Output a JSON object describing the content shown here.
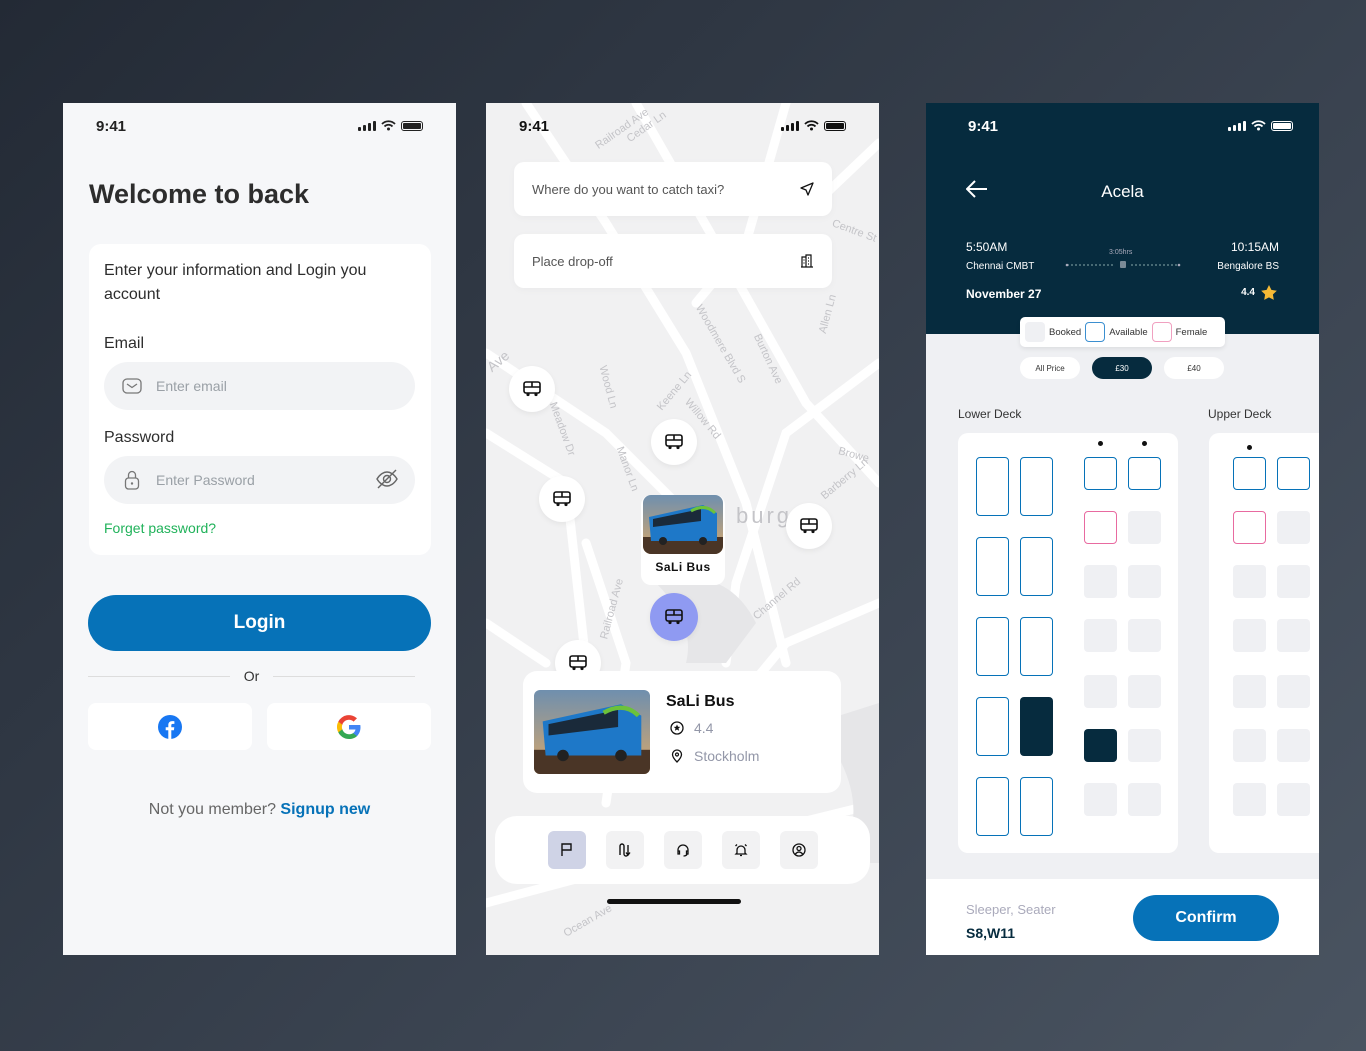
{
  "login_screen": {
    "time": "9:41",
    "title": "Welcome to back",
    "intro": "Enter your information and Login you account",
    "email_label": "Email",
    "email_placeholder": "Enter email",
    "password_label": "Password",
    "password_placeholder": "Enter Password",
    "forgot": "Forget password?",
    "login": "Login",
    "or": "Or",
    "signup_prompt": "Not you member?",
    "signup_link": "Signup new",
    "colors": {
      "primary": "#0672b8",
      "link_green": "#20b25a"
    }
  },
  "map_screen": {
    "time": "9:41",
    "search_placeholder": "Where do you want to catch taxi?",
    "dropoff_placeholder": "Place drop-off",
    "map_labels": [
      "Railroad Ave",
      "Cedar Ln",
      "Woodmere Blvd S",
      "Burton Ave",
      "Keene Ln",
      "Willow Rd",
      "Wood Ln",
      "Meadow Dr",
      "Manor Ln",
      "Railroad Ave",
      "Channel Rd",
      "Barberry Ln",
      "Browe",
      "Allen Ln",
      "Centre St",
      "Ocean Ave",
      "burg",
      "Ave"
    ],
    "bubble_name": "SaLi Bus",
    "card": {
      "name": "SaLi Bus",
      "rating": "4.4",
      "location": "Stockholm"
    },
    "tabs": [
      "flag-icon",
      "route-icon",
      "headset-icon",
      "alarm-icon",
      "profile-icon"
    ],
    "active_tab": 0,
    "colors": {
      "active_pin": "#8f9af2",
      "active_tab": "#cfd3e6"
    }
  },
  "seat_screen": {
    "time": "9:41",
    "title": "Acela",
    "depart_time": "5:50AM",
    "depart_station": "Chennai CMBT",
    "duration": "3:05hrs",
    "arrive_time": "10:15AM",
    "arrive_station": "Bengalore BS",
    "date": "November 27",
    "rating": "4.4",
    "legend": [
      "Booked",
      "Available",
      "Female"
    ],
    "prices": [
      "All Price",
      "£30",
      "£40"
    ],
    "selected_price": "£30",
    "lower_deck": "Lower Deck",
    "upper_deck": "Upper Deck",
    "seat_type": "Sleeper, Seater",
    "selected_seats": "S8,W11",
    "confirm": "Confirm",
    "colors": {
      "header": "#062b3e",
      "available": "#0672b8",
      "female": "#e86aa0",
      "booked": "#eff0f3",
      "star": "#f5b935"
    }
  }
}
